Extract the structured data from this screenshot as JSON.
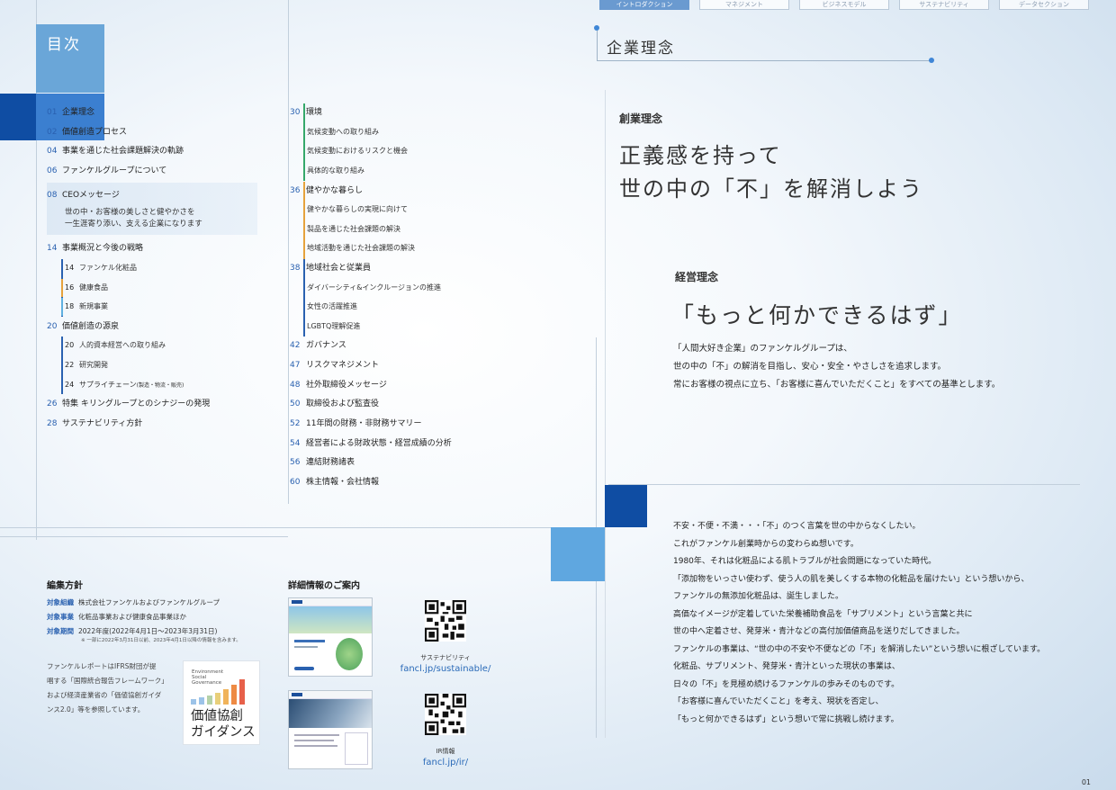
{
  "nav": {
    "tabs": [
      {
        "label": "イントロダクション",
        "active": true
      },
      {
        "label": "マネジメント",
        "active": false
      },
      {
        "label": "ビジネスモデル",
        "active": false
      },
      {
        "label": "サステナビリティ",
        "active": false
      },
      {
        "label": "データセクション",
        "active": false
      }
    ]
  },
  "toc": {
    "title": "目次",
    "col1": [
      {
        "num": "01",
        "text": "企業理念"
      },
      {
        "num": "02",
        "text": "価値創造プロセス"
      },
      {
        "num": "04",
        "text": "事業を通じた社会課題解決の軌跡"
      },
      {
        "num": "06",
        "text": "ファンケルグループについて"
      },
      {
        "num": "08",
        "text": "CEOメッセージ",
        "lines": [
          "世の中・お客様の美しさと健やかさを",
          "一生涯寄り添い、支える企業になります"
        ]
      },
      {
        "num": "14",
        "text": "事業概況と今後の戦略"
      },
      {
        "num": "14",
        "text": "ファンケル化粧品"
      },
      {
        "num": "16",
        "text": "健康食品"
      },
      {
        "num": "18",
        "text": "新規事業"
      },
      {
        "num": "20",
        "text": "価値創造の源泉"
      },
      {
        "num": "20",
        "text": "人的資本経営への取り組み"
      },
      {
        "num": "22",
        "text": "研究開発"
      },
      {
        "num": "24",
        "text": "サプライチェーン",
        "note": "(製造・物流・販売)"
      },
      {
        "num": "26",
        "text": "特集 キリングループとのシナジーの発現"
      },
      {
        "num": "28",
        "text": "サステナビリティ方針"
      }
    ],
    "col2": [
      {
        "num": "30",
        "text": "環境",
        "subs": [
          "気候変動への取り組み",
          "気候変動におけるリスクと機会",
          "具体的な取り組み"
        ]
      },
      {
        "num": "36",
        "text": "健やかな暮らし",
        "subs": [
          "健やかな暮らしの実現に向けて",
          "製品を通じた社会課題の解決",
          "地域活動を通じた社会課題の解決"
        ]
      },
      {
        "num": "38",
        "text": "地域社会と従業員",
        "subs": [
          "ダイバーシティ&インクルージョンの推進",
          "女性の活躍推進",
          "LGBTQ理解促進"
        ]
      },
      {
        "num": "42",
        "text": "ガバナンス"
      },
      {
        "num": "47",
        "text": "リスクマネジメント"
      },
      {
        "num": "48",
        "text": "社外取締役メッセージ"
      },
      {
        "num": "50",
        "text": "取締役および監査役"
      },
      {
        "num": "52",
        "text": "11年間の財務・非財務サマリー"
      },
      {
        "num": "54",
        "text": "経営者による財政状態・経営成績の分析"
      },
      {
        "num": "56",
        "text": "連結財務諸表"
      },
      {
        "num": "60",
        "text": "株主情報・会社情報"
      }
    ]
  },
  "editorial": {
    "title": "編集方針",
    "rows": [
      {
        "key": "対象組織",
        "value": "株式会社ファンケルおよびファンケルグループ"
      },
      {
        "key": "対象事業",
        "value": "化粧品事業および健康食品事業ほか"
      },
      {
        "key": "対象期間",
        "value": "2022年度(2022年4月1日〜2023年3月31日)"
      }
    ],
    "note": "※ 一部に2022年3月31日以前、2023年4月1日以降の情報を含みます。",
    "para": [
      "ファンケルレポートはIFRS財団が提",
      "唱する「国際統合報告フレームワーク」",
      "および経済産業省の「価値協創ガイダ",
      "ンス2.0」等を参照しています。"
    ],
    "badge": {
      "lines": [
        "Environment",
        "Social",
        "Governance"
      ],
      "title1": "価値協創",
      "title2": "ガイダンス"
    }
  },
  "details": {
    "title": "詳細情報のご案内",
    "items": [
      {
        "caption": "サステナビリティ",
        "url": "fancl.jp/sustainable/"
      },
      {
        "caption": "IR情報",
        "url": "fancl.jp/ir/"
      }
    ]
  },
  "right": {
    "section_title": "企業理念",
    "founding_label": "創業理念",
    "founding_lines": [
      "正義感を持って",
      "世の中の「不」を解消しよう"
    ],
    "mgmt_label": "経営理念",
    "mgmt_copy": "「もっと何かできるはず」",
    "mgmt_para": [
      "「人間大好き企業」のファンケルグループは、",
      "世の中の「不」の解消を目指し、安心・安全・やさしさを追求します。",
      "常にお客様の視点に立ち、「お客様に喜んでいただくこと」をすべての基準とします。"
    ],
    "story": [
      "不安・不便・不満・・・「不」のつく言葉を世の中からなくしたい。",
      "これがファンケル創業時からの変わらぬ想いです。",
      "1980年、それは化粧品による肌トラブルが社会問題になっていた時代。",
      "「添加物をいっさい使わず、使う人の肌を美しくする本物の化粧品を届けたい」という想いから、",
      "ファンケルの無添加化粧品は、誕生しました。",
      "高価なイメージが定着していた栄養補助食品を「サプリメント」という言葉と共に",
      "世の中へ定着させ、発芽米・青汁などの高付加価値商品を送りだしてきました。",
      "ファンケルの事業は、“世の中の不安や不便などの「不」を解消したい”という想いに根ざしています。",
      "化粧品、サプリメント、発芽米・青汁といった現状の事業は、",
      "日々の「不」を見極め続けるファンケルの歩みそのものです。",
      "「お客様に喜んでいただくこと」を考え、現状を否定し、",
      "「もっと何かできるはず」という想いで常に挑戦し続けます。"
    ]
  },
  "page_number": "01",
  "colors": {
    "accent": "#2a61b0",
    "navy": "#0f4da3",
    "light": "#6aa6d8"
  }
}
